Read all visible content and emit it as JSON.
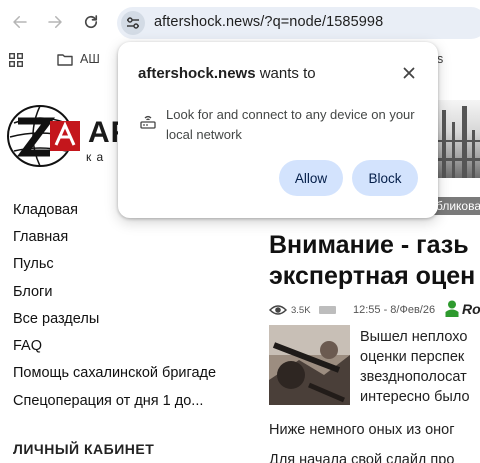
{
  "browser": {
    "url": "aftershock.news/?q=node/1585998",
    "bookmarks": {
      "folder_label": "АШ",
      "right_fragment": "s"
    }
  },
  "popup": {
    "site": "aftershock.news",
    "title_suffix": " wants to",
    "permission_text": "Look for and connect to any device on your local network",
    "allow_label": "Allow",
    "block_label": "Block"
  },
  "site": {
    "logo_text": "AF",
    "logo_sub": "ка"
  },
  "sidebar": {
    "items": [
      {
        "label": "Кладовая"
      },
      {
        "label": "Главная"
      },
      {
        "label": "Пульс"
      },
      {
        "label": "Блоги"
      },
      {
        "label": "Все разделы"
      },
      {
        "label": "FAQ"
      },
      {
        "label": "Помощь сахалинской бригаде"
      },
      {
        "label": "Спецоперация от дня 1 до..."
      }
    ],
    "section_title": "ЛИЧНЫЙ КАБИНЕТ"
  },
  "article": {
    "tag_label": "бликова",
    "headline_line1": "Внимание - газь",
    "headline_line2": "экспертная оцен",
    "views": "3.5K",
    "datetime": "12:55 - 8/Фев/26",
    "author": "Ro",
    "excerpt_lines": [
      "Вышел неплохо",
      "оценки перспек",
      "звезднополосат",
      "интересно было"
    ],
    "body_line1": "Ниже немного оных из оног",
    "body_line2": "Для начала свой слайд про"
  },
  "colors": {
    "omnibox_bg": "#e9eef6",
    "button_bg": "#d3e3fd",
    "button_text": "#041e49",
    "user_icon": "#2e9a2e"
  }
}
